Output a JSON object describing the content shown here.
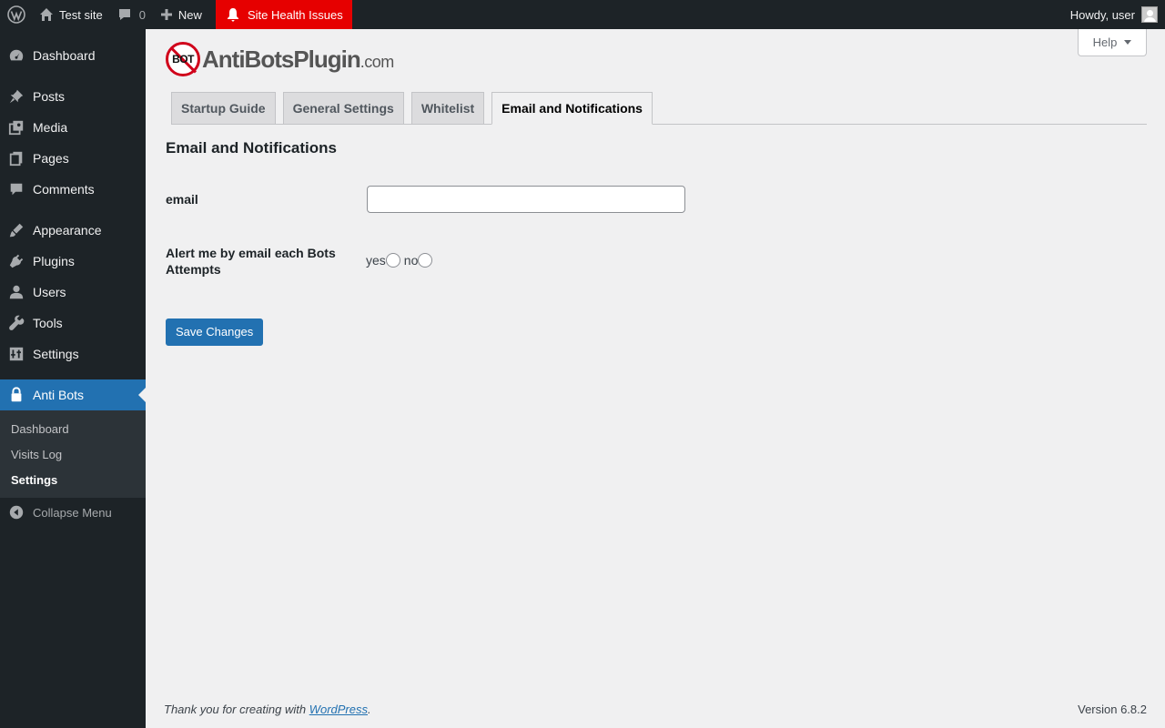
{
  "adminbar": {
    "site_name": "Test site",
    "comments_count": "0",
    "new_label": "New",
    "health_label": "Site Health Issues",
    "howdy": "Howdy, user"
  },
  "sidebar": {
    "items": [
      {
        "label": "Dashboard",
        "icon": "dashboard-icon"
      },
      {
        "label": "Posts",
        "icon": "pin-icon"
      },
      {
        "label": "Media",
        "icon": "media-icon"
      },
      {
        "label": "Pages",
        "icon": "pages-icon"
      },
      {
        "label": "Comments",
        "icon": "comment-icon"
      },
      {
        "label": "Appearance",
        "icon": "brush-icon"
      },
      {
        "label": "Plugins",
        "icon": "plug-icon"
      },
      {
        "label": "Users",
        "icon": "user-icon"
      },
      {
        "label": "Tools",
        "icon": "wrench-icon"
      },
      {
        "label": "Settings",
        "icon": "settings-icon"
      },
      {
        "label": "Anti Bots",
        "icon": "lock-icon"
      }
    ],
    "submenu": [
      "Dashboard",
      "Visits Log",
      "Settings"
    ],
    "collapse": "Collapse Menu"
  },
  "help_label": "Help",
  "logo": {
    "badge": "BOT",
    "text": "AntiBotsPlugin",
    "suffix": ".com"
  },
  "tabs": [
    "Startup Guide",
    "General Settings",
    "Whitelist",
    "Email and Notifications"
  ],
  "section_title": "Email and Notifications",
  "form": {
    "email_label": "email",
    "email_value": "",
    "alert_label": "Alert me by email each Bots Attempts",
    "yes_label": "yes",
    "no_label": "no",
    "save_label": "Save Changes"
  },
  "footer": {
    "thanks_prefix": "Thank you for creating with ",
    "wordpress_link": "WordPress",
    "thanks_suffix": ".",
    "version": "Version 6.8.2"
  },
  "colors": {
    "admin_dark": "#1d2327",
    "accent": "#2271b1",
    "health_red": "#e60000"
  }
}
